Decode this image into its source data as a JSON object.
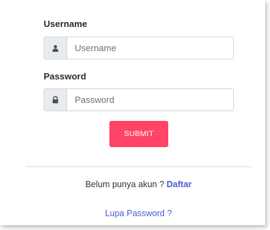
{
  "form": {
    "username_label": "Username",
    "username_placeholder": "Username",
    "password_label": "Password",
    "password_placeholder": "Password",
    "submit_label": "SUBMIT"
  },
  "footer": {
    "register_prompt": "Belum punya akun ? ",
    "register_link": "Daftar",
    "forgot_link": "Lupa Password ?"
  },
  "icons": {
    "username_addon": "user-icon",
    "password_addon": "lock-icon"
  },
  "colors": {
    "submit_bg": "#ff4466",
    "link": "#4a5bd6",
    "addon_bg": "#e9ecef"
  }
}
